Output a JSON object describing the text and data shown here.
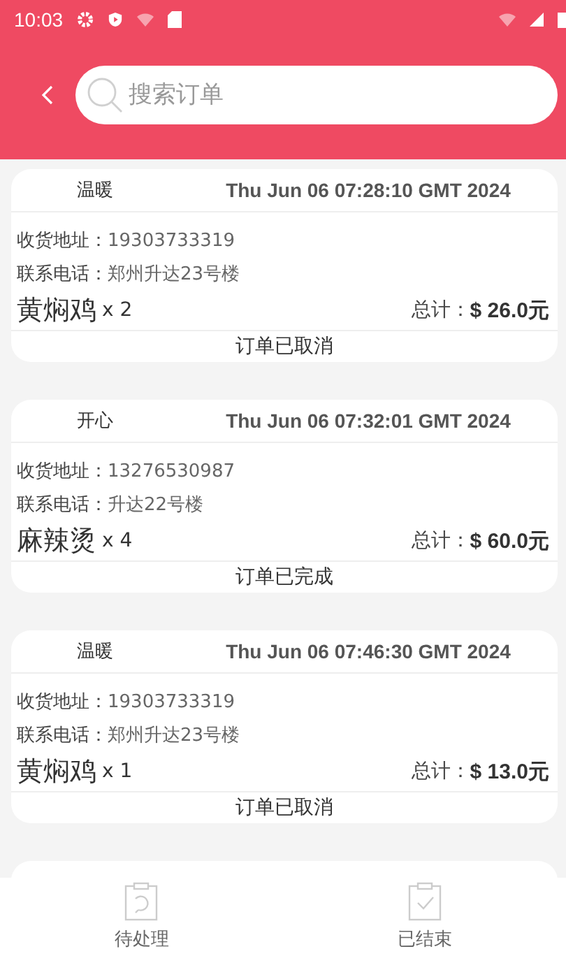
{
  "status_bar": {
    "time": "10:03"
  },
  "search": {
    "placeholder": "搜索订单"
  },
  "orders": [
    {
      "name": "温暖",
      "date": "Thu Jun 06 07:28:10 GMT 2024",
      "address_label": "收货地址：",
      "address": "19303733319",
      "phone_label": "联系电话：",
      "phone": "郑州升达23号楼",
      "dish": "黄焖鸡",
      "quantity": "x 2",
      "total_label": "总计：",
      "total": "$ 26.0元",
      "status": "订单已取消"
    },
    {
      "name": "开心",
      "date": "Thu Jun 06 07:32:01 GMT 2024",
      "address_label": "收货地址：",
      "address": "13276530987",
      "phone_label": "联系电话：",
      "phone": "升达22号楼",
      "dish": "麻辣烫",
      "quantity": "x 4",
      "total_label": "总计：",
      "total": "$ 60.0元",
      "status": "订单已完成"
    },
    {
      "name": "温暖",
      "date": "Thu Jun 06 07:46:30 GMT 2024",
      "address_label": "收货地址：",
      "address": "19303733319",
      "phone_label": "联系电话：",
      "phone": "郑州升达23号楼",
      "dish": "黄焖鸡",
      "quantity": "x 1",
      "total_label": "总计：",
      "total": "$ 13.0元",
      "status": "订单已取消"
    }
  ],
  "bottom_nav": [
    {
      "label": "待处理",
      "kind": "pending"
    },
    {
      "label": "已结束",
      "kind": "done"
    }
  ]
}
